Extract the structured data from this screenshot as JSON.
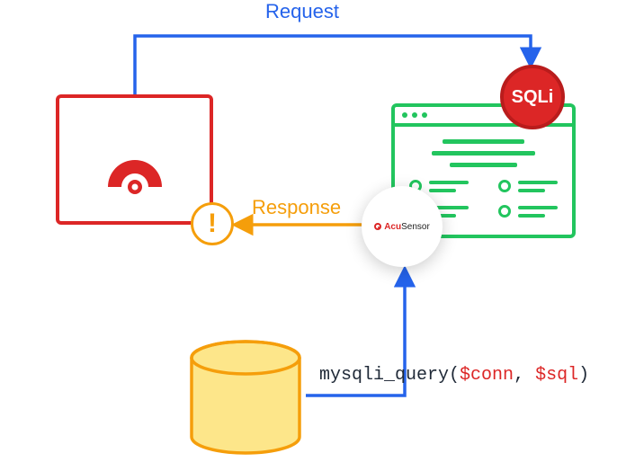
{
  "labels": {
    "request": "Request",
    "response": "Response"
  },
  "sqli": {
    "text": "SQLi"
  },
  "acusensor": {
    "brand_prefix": "Acu",
    "brand_suffix": "Sensor"
  },
  "alert": {
    "glyph": "!"
  },
  "code": {
    "fn": "mysqli_query",
    "arg1": "$conn",
    "arg2": "$sql"
  },
  "colors": {
    "blue": "#2563eb",
    "orange": "#f59e0b",
    "red": "#dc2626",
    "darkred": "#b91c1c",
    "green": "#22c55e",
    "dbfill": "#fde68a",
    "dbstroke": "#f59e0b"
  }
}
